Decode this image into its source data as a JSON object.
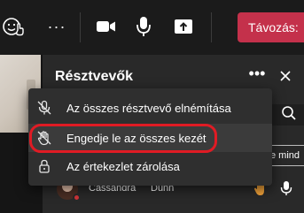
{
  "toolbar": {
    "leave_label": "Távozás:",
    "icons": [
      "react-icon",
      "more-options-icon",
      "camera-icon",
      "microphone-icon",
      "share-screen-icon"
    ],
    "leave_color": "#c4314b"
  },
  "panel": {
    "title": "Résztvevők",
    "more_icon": "•••",
    "mute_all_partial": "e mind"
  },
  "menu": {
    "items": [
      {
        "label": "Az összes résztvevő elnémítása",
        "icon": "mic-off-icon"
      },
      {
        "label": "Engedje le az összes kezét",
        "icon": "hand-off-icon"
      },
      {
        "label": "Az értekezlet zárolása",
        "icon": "lock-icon"
      }
    ],
    "highlight_color": "#e01b24"
  },
  "participant": {
    "first_name": "Cassandra",
    "last_name": "Dunn",
    "presence_color": "#d13438",
    "hand_color": "#f2a33a"
  }
}
